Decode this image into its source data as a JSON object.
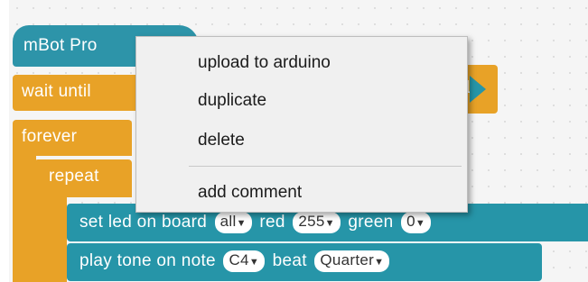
{
  "blocks": {
    "hat_label": "mBot Pro",
    "wait_label": "wait until",
    "forever_label": "forever",
    "repeat_label": "repeat",
    "set_led": {
      "prefix": "set led on board",
      "led_value": "all",
      "red_label": "red",
      "red_value": "255",
      "green_label": "green",
      "green_value": "0"
    },
    "play_tone": {
      "prefix": "play tone on note",
      "note_value": "C4",
      "beat_label": "beat",
      "beat_value": "Quarter"
    }
  },
  "context_menu": {
    "items": [
      "upload to arduino",
      "duplicate",
      "delete"
    ],
    "comment_item": "add comment"
  },
  "dropdown_arrow": "▼",
  "colors": {
    "hat": "#2d94a9",
    "control": "#e8a227",
    "action": "#2695a8",
    "menu_bg": "#f0f0f0"
  }
}
